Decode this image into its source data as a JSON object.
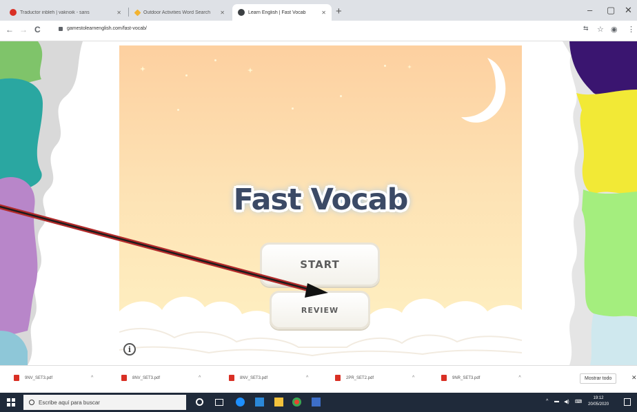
{
  "browser": {
    "tabs": [
      {
        "title": "Traductor inbleh | vaknoik - sans",
        "favicon_color": "#d93025",
        "active": false
      },
      {
        "title": "Outdoor Activities Word Search",
        "favicon_color": "#f2b330",
        "active": false
      },
      {
        "title": "Learn English | Fast Vocab",
        "favicon_color": "#3c4043",
        "active": true
      }
    ],
    "new_tab_symbol": "+",
    "window_controls": {
      "minimize": "–",
      "maximize": "▢",
      "close": "✕"
    },
    "nav": {
      "back": "←",
      "forward": "→",
      "reload": "C"
    },
    "address": "gamestolearnenglish.com/fast-vocab/"
  },
  "game": {
    "title": "Fast Vocab",
    "start_label": "START",
    "review_label": "REVIEW",
    "info_symbol": "i"
  },
  "downloads": {
    "items": [
      "9NV_SET3.pdf",
      "8NV_SET3.pdf",
      "8NV_SET3.pdf",
      "2PR_SET2.pdf",
      "9NR_SET3.pdf"
    ],
    "show_all_label": "Mostrar todo",
    "close_symbol": "✕"
  },
  "taskbar": {
    "search_placeholder": "Escribe aquí para buscar",
    "time": "19:12",
    "date": "20/05/2020"
  },
  "colors": {
    "annotation_arrow": "#b22b2b",
    "game_sky_top": "#fdd0a0",
    "game_sky_bottom": "#fff2c4",
    "title_text": "#3b4a66"
  }
}
